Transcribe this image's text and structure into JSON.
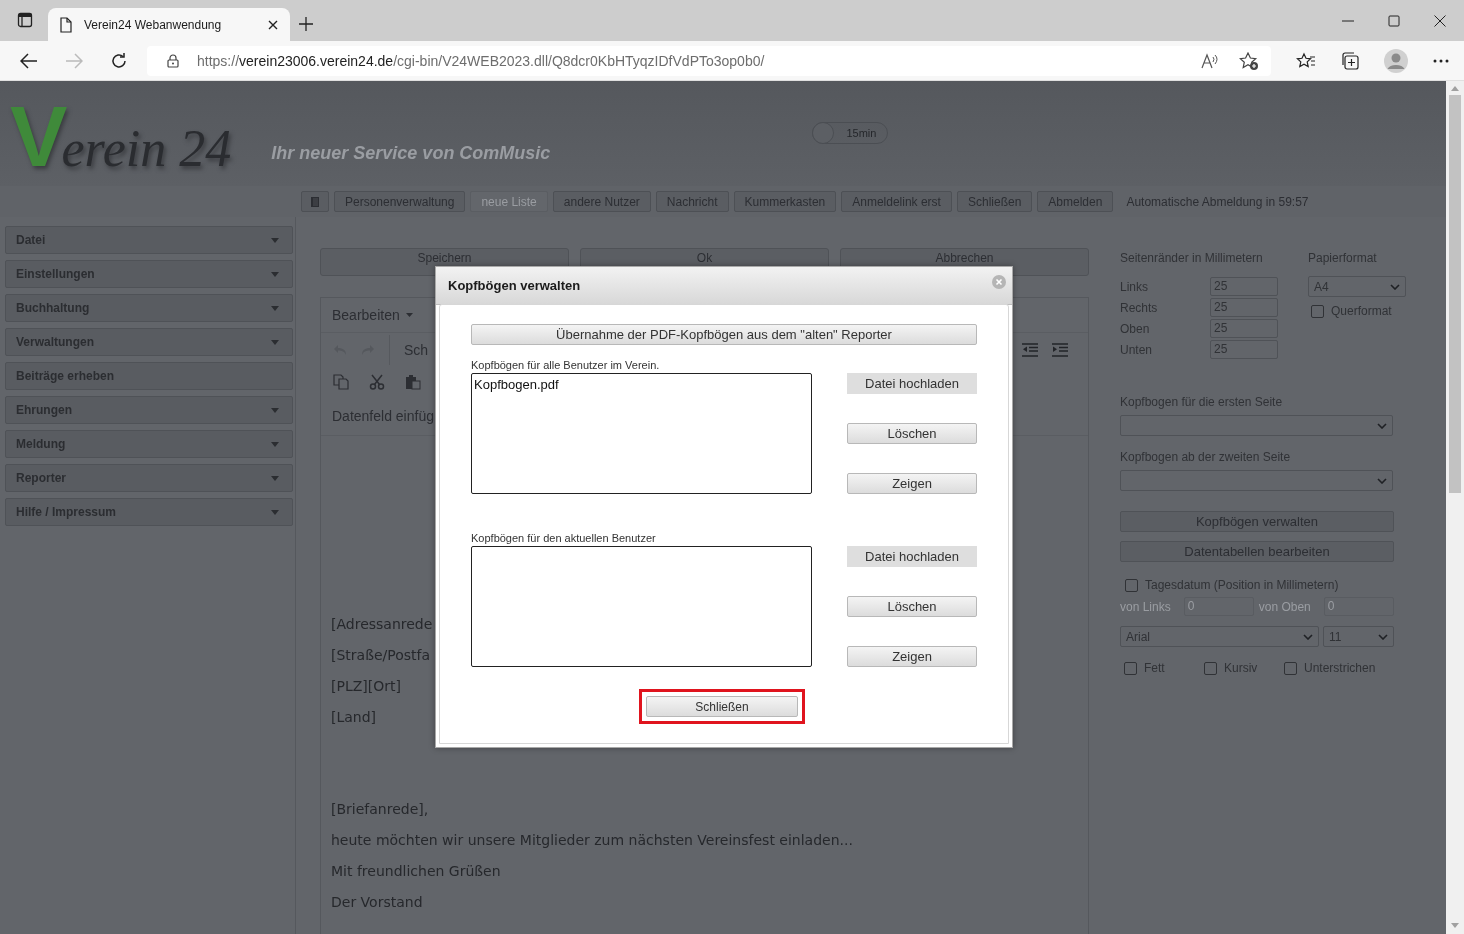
{
  "browser": {
    "tab_title": "Verein24 Webanwendung",
    "url_scheme": "https://",
    "url_host": "verein23006.verein24.de",
    "url_path": "/cgi-bin/V24WEB2023.dll/Q8dcr0KbHTyqzIDfVdPTo3op0b0/"
  },
  "header": {
    "logo_initial": "V",
    "logo_rest": "erein 24",
    "slogan": "Ihr neuer Service von ComMusic",
    "timeout_toggle": {
      "label": "15min",
      "on": false
    }
  },
  "nav": {
    "buttons": [
      {
        "kind": "icon",
        "disabled": false
      },
      {
        "kind": "text",
        "label": "Personenverwaltung",
        "disabled": false
      },
      {
        "kind": "text",
        "label": "neue Liste",
        "disabled": true
      },
      {
        "kind": "text",
        "label": "andere Nutzer",
        "disabled": false
      },
      {
        "kind": "text",
        "label": "Nachricht",
        "disabled": false
      },
      {
        "kind": "text",
        "label": "Kummerkasten",
        "disabled": false
      },
      {
        "kind": "text",
        "label": "Anmeldelink erst",
        "disabled": false
      },
      {
        "kind": "text",
        "label": "Schließen",
        "disabled": false
      },
      {
        "kind": "text",
        "label": "Abmelden",
        "disabled": false
      }
    ],
    "status": "Automatische Abmeldung in 59:57"
  },
  "sidebar": {
    "items": [
      {
        "label": "Datei",
        "expandable": true
      },
      {
        "label": "Einstellungen",
        "expandable": true
      },
      {
        "label": "Buchhaltung",
        "expandable": true
      },
      {
        "label": "Verwaltungen",
        "expandable": true
      },
      {
        "label": "Beiträge erheben",
        "expandable": false
      },
      {
        "label": "Ehrungen",
        "expandable": true
      },
      {
        "label": "Meldung",
        "expandable": true
      },
      {
        "label": "Reporter",
        "expandable": true
      },
      {
        "label": "Hilfe / Impressum",
        "expandable": true
      }
    ]
  },
  "editor": {
    "actions": [
      "Speichern",
      "Ok",
      "Abbrechen"
    ],
    "menu": "Bearbeiten",
    "style_label": "Sch",
    "field_label": "Datenfeld einfüg",
    "address_lines": [
      "[Adressanrede",
      "[Straße/Postfa",
      "[PLZ][Ort]",
      "[Land]"
    ],
    "letter_lines": [
      "[Briefanrede],",
      "heute möchten wir unsere Mitglieder zum nächsten Vereinsfest einladen...",
      "Mit freundlichen Grüßen",
      "Der Vorstand"
    ]
  },
  "settings": {
    "margins_title": "Seitenränder in Millimetern",
    "margins": [
      {
        "label": "Links",
        "value": "25"
      },
      {
        "label": "Rechts",
        "value": "25"
      },
      {
        "label": "Oben",
        "value": "25"
      },
      {
        "label": "Unten",
        "value": "25"
      }
    ],
    "paper_title": "Papierformat",
    "paper_value": "A4",
    "landscape": {
      "label": "Querformat",
      "checked": false
    },
    "first_page_label": "Kopfbogen für die ersten Seite",
    "second_page_label": "Kopfbogen ab der zweiten Seite",
    "buttons": [
      "Kopfbögen verwalten",
      "Datentabellen bearbeiten"
    ],
    "date": {
      "label": "Tagesdatum (Position in Millimetern)",
      "checked": false
    },
    "date_position": [
      {
        "label": "von Links",
        "value": "0",
        "disabled": true
      },
      {
        "label": "von Oben",
        "value": "0",
        "disabled": true
      }
    ],
    "font": "Arial",
    "size": "11",
    "styles": [
      {
        "label": "Fett",
        "checked": false
      },
      {
        "label": "Kursiv",
        "checked": false
      },
      {
        "label": "Unterstrichen",
        "checked": false
      }
    ]
  },
  "dialog": {
    "title": "Kopfbögen verwalten",
    "import_button": "Übernahme der PDF-Kopfbögen aus dem \"alten\" Reporter",
    "sections": [
      {
        "label": "Kopfbögen für alle Benutzer im Verein.",
        "files": [
          "Kopfbogen.pdf"
        ],
        "buttons": [
          "Datei hochladen",
          "Löschen",
          "Zeigen"
        ]
      },
      {
        "label": "Kopfbögen für den aktuellen Benutzer",
        "buttons": [
          "Datei hochladen",
          "Löschen",
          "Zeigen"
        ]
      }
    ],
    "close_button": {
      "label": "Schließen",
      "highlighted": true
    }
  }
}
